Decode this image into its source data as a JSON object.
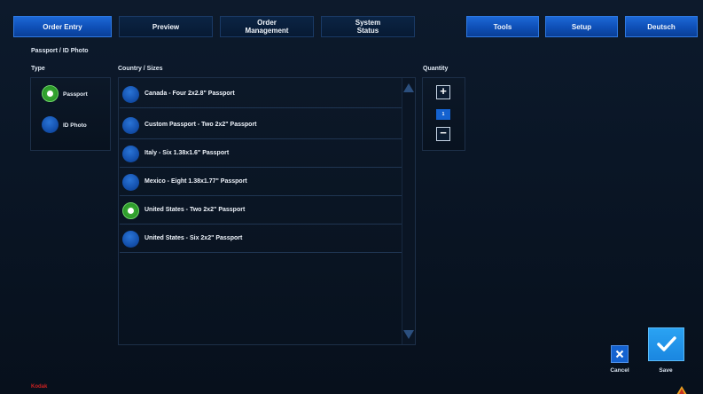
{
  "nav": {
    "order_entry": "Order Entry",
    "preview": "Preview",
    "order_management_line1": "Order",
    "order_management_line2": "Management",
    "system_status_line1": "System",
    "system_status_line2": "Status",
    "tools": "Tools",
    "setup": "Setup",
    "language": "Deutsch"
  },
  "page_title": "Passport / ID Photo",
  "type_section": {
    "header": "Type",
    "options": [
      {
        "label": "Passport",
        "selected": true
      },
      {
        "label": "ID Photo",
        "selected": false
      }
    ]
  },
  "sizes_section": {
    "header": "Country / Sizes",
    "items": [
      {
        "label": "Canada - Four 2x2.8\" Passport",
        "selected": false
      },
      {
        "label": "Custom Passport - Two 2x2\" Passport",
        "selected": false
      },
      {
        "label": "Italy - Six 1.38x1.6\" Passport",
        "selected": false
      },
      {
        "label": "Mexico - Eight 1.38x1.77\" Passport",
        "selected": false
      },
      {
        "label": "United States - Two 2x2\" Passport",
        "selected": true
      },
      {
        "label": "United States - Six 2x2\" Passport",
        "selected": false
      }
    ]
  },
  "quantity_section": {
    "header": "Quantity",
    "value": "1",
    "plus": "+",
    "minus": "−"
  },
  "actions": {
    "cancel": "Cancel",
    "save": "Save"
  },
  "footer": {
    "brand": "Kodak"
  },
  "colors": {
    "accent": "#1462d0",
    "selected": "#3fb53a",
    "save_bg": "#1d8fe8"
  }
}
